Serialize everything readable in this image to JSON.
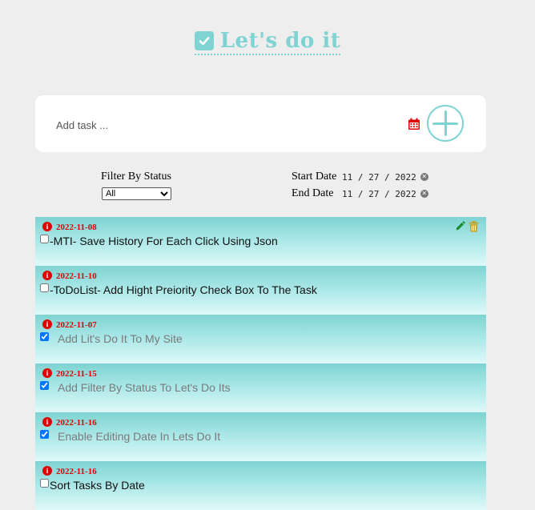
{
  "header": {
    "title": "Let's do it"
  },
  "add_task": {
    "placeholder": "Add task ..."
  },
  "filter": {
    "label": "Filter By Status",
    "selected": "All"
  },
  "dates": {
    "start_label": "Start Date",
    "start_value": "11 / 27 / 2022",
    "end_label": "End Date",
    "end_value": "11 / 27 / 2022"
  },
  "tasks": [
    {
      "date": "2022-11-08",
      "text": "-MTI- Save History For Each Click Using Json",
      "done": false
    },
    {
      "date": "2022-11-10",
      "text": "-ToDoList- Add Hight Preiority Check Box To The Task",
      "done": false
    },
    {
      "date": "2022-11-07",
      "text": "Add Lit's Do It To My Site",
      "done": true
    },
    {
      "date": "2022-11-15",
      "text": "Add Filter By Status To Let's Do Its",
      "done": true
    },
    {
      "date": "2022-11-16",
      "text": "Enable Editing Date In Lets Do It",
      "done": true
    },
    {
      "date": "2022-11-16",
      "text": "Sort Tasks By Date",
      "done": false
    }
  ],
  "colors": {
    "accent": "#7fd3d3",
    "date_red": "#e00000",
    "edit_green": "#1a8c2a",
    "trash_gold": "#c8a020"
  },
  "icons": {
    "logo": "check-square-icon",
    "calendar": "calendar-icon",
    "add": "plus-circle-icon",
    "info": "info-icon",
    "edit": "pencil-icon",
    "delete": "trash-icon"
  }
}
